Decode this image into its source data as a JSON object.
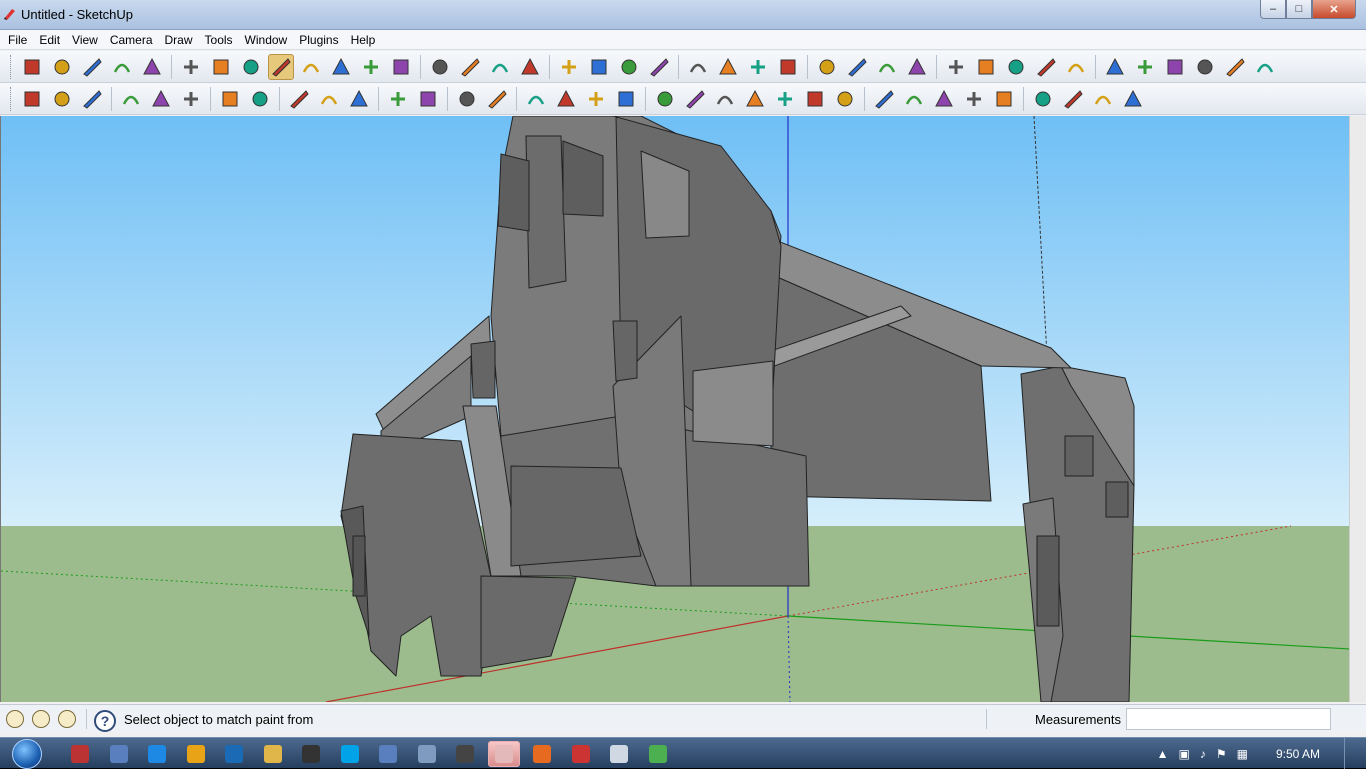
{
  "window": {
    "title": "Untitled - SketchUp"
  },
  "window_controls": {
    "minimize": "–",
    "maximize": "□",
    "close": "✕"
  },
  "menu": [
    "File",
    "Edit",
    "View",
    "Camera",
    "Draw",
    "Tools",
    "Window",
    "Plugins",
    "Help"
  ],
  "toolbar_row1": [
    "select-icon",
    "pencil-icon",
    "rectangle-icon",
    "circle-icon",
    "arc-icon",
    "make-component-icon",
    "eraser-icon",
    "tape-measure-icon",
    "paint-bucket-icon",
    "push-pull-icon",
    "move-icon",
    "rotate-icon",
    "follow-me-icon",
    "orbit-icon",
    "pan-icon",
    "zoom-icon",
    "zoom-extents-icon",
    "add-location-icon",
    "toggle-terrain-icon",
    "get-models-icon",
    "share-model-icon",
    "google-earth-icon",
    "get-components-icon",
    "share-component-icon",
    "component-icon",
    "select-icon",
    "component-icon",
    "paint-bucket-icon",
    "eraser-icon",
    "rectangle-icon",
    "line-icon",
    "circle-icon",
    "arc-icon",
    "polygon-icon",
    "freehand-icon",
    "move-icon",
    "push-pull-icon",
    "rotate-icon",
    "follow-me-icon",
    "scale-icon"
  ],
  "toolbar_row2": [
    "iso-view-icon",
    "top-view-icon",
    "front-view-icon",
    "walk-icon",
    "look-around-icon",
    "position-camera-icon",
    "section-plane-icon",
    "axes-icon",
    "dimension-icon",
    "protractor-icon",
    "text-icon",
    "undo-icon",
    "redo-icon",
    "zoom-window-icon",
    "sandbox-from-contours-icon",
    "sandbox-from-scratch-icon",
    "smoove-icon",
    "stamp-icon",
    "drape-icon",
    "add-detail-icon",
    "flip-edge-icon",
    "bezier-icon",
    "spline-icon",
    "arc-tool-icon",
    "circle-tool-icon",
    "line-tool-icon",
    "text-3d-icon",
    "protractor-icon",
    "dimension-icon",
    "move-icon",
    "rotate-icon",
    "page-icon",
    "x-ray-icon",
    "back-edges-icon",
    "wireframe-icon"
  ],
  "status": {
    "hint": "Select object to match paint from",
    "measurements_label": "Measurements",
    "measurements_value": ""
  },
  "taskbar": {
    "apps": [
      "start-button",
      "sketchup-icon",
      "itunes-icon",
      "internet-explorer-icon",
      "media-player-icon",
      "photoshop-icon",
      "explorer-icon",
      "steam-icon",
      "skype-icon",
      "itunes-icon",
      "folder-icon",
      "7zip-icon",
      "sketchup-icon",
      "firefox-icon",
      "app-icon",
      "notepad-icon",
      "chrome-icon"
    ],
    "clock": "9:50 AM"
  },
  "colors": {
    "sky_top": "#6fbff5",
    "sky_bottom": "#d6eefb",
    "ground": "#9cbc8d",
    "model": "#777777",
    "red_axis": "#c0302b",
    "green_axis": "#1a9b1a",
    "blue_axis": "#2330c8"
  }
}
